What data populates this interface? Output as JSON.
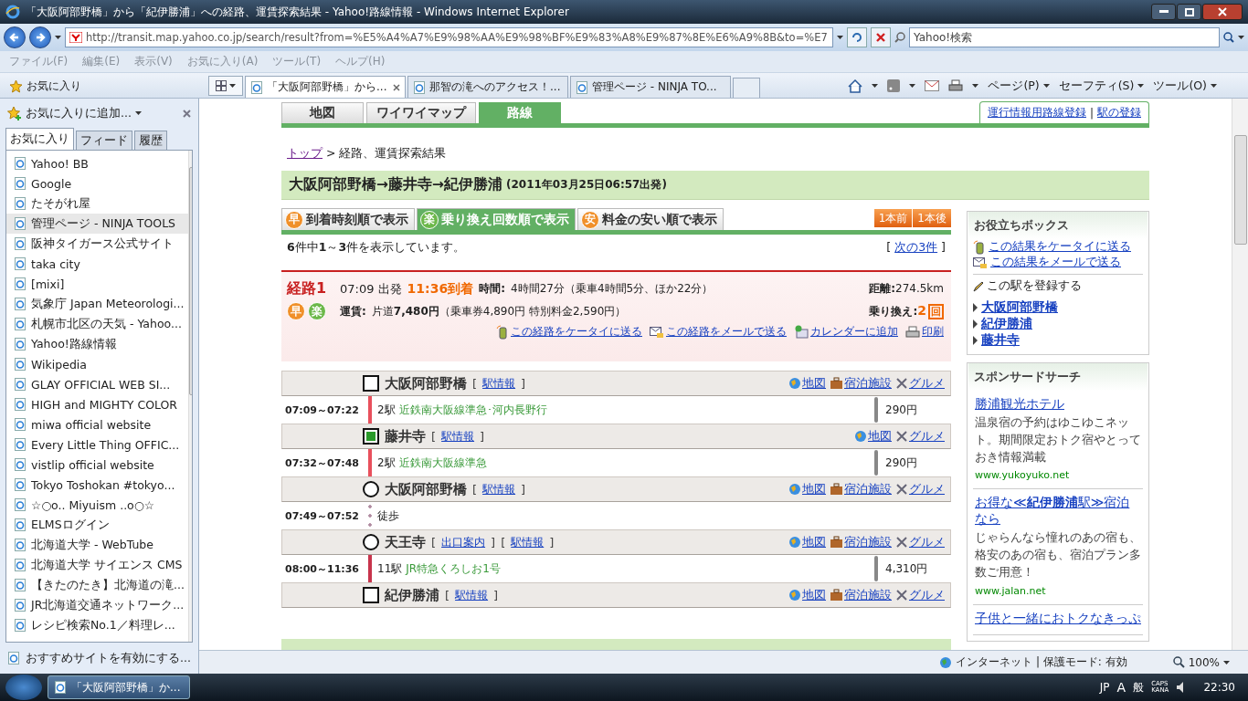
{
  "window": {
    "title": "「大阪阿部野橋」から「紀伊勝浦」への経路、運賃探索結果 - Yahoo!路線情報 - Windows Internet Explorer"
  },
  "address": {
    "url": "http://transit.map.yahoo.co.jp/search/result?from=%E5%A4%A7%E9%98%AA%E9%98%BF%E9%83%A8%E9%87%8E%E6%A9%8B&to=%E7"
  },
  "search": {
    "placeholder": "Yahoo!検索"
  },
  "menu": [
    "ファイル(F)",
    "編集(E)",
    "表示(V)",
    "お気に入り(A)",
    "ツール(T)",
    "ヘルプ(H)"
  ],
  "favorites_button": "お気に入り",
  "browser_tabs": [
    {
      "label": "「大阪阿部野橋」から...",
      "selected": true
    },
    {
      "label": "那智の滝へのアクセス！...",
      "selected": false
    },
    {
      "label": "管理ページ - NINJA TO...",
      "selected": false
    }
  ],
  "command_menus": [
    "ページ(P)",
    "セーフティ(S)",
    "ツール(O)"
  ],
  "favorites_pane": {
    "add_label": "お気に入りに追加...",
    "tabs": [
      {
        "label": "お気に入り",
        "selected": true
      },
      {
        "label": "フィード",
        "selected": false
      },
      {
        "label": "履歴",
        "selected": false
      }
    ],
    "items": [
      {
        "label": "Yahoo! BB",
        "selected": false
      },
      {
        "label": "Google",
        "selected": false
      },
      {
        "label": "たそがれ屋",
        "selected": false
      },
      {
        "label": "管理ページ - NINJA TOOLS",
        "selected": true
      },
      {
        "label": "阪神タイガース公式サイト",
        "selected": false
      },
      {
        "label": "taka city",
        "selected": false
      },
      {
        "label": "[mixi]",
        "selected": false
      },
      {
        "label": "気象庁 Japan Meteorologi...",
        "selected": false
      },
      {
        "label": "札幌市北区の天気 - Yahoo...",
        "selected": false
      },
      {
        "label": "Yahoo!路線情報",
        "selected": false
      },
      {
        "label": "Wikipedia",
        "selected": false
      },
      {
        "label": "GLAY OFFICIAL WEB SI...",
        "selected": false
      },
      {
        "label": "HIGH and MIGHTY COLOR",
        "selected": false
      },
      {
        "label": "miwa official website",
        "selected": false
      },
      {
        "label": "Every Little Thing OFFIC...",
        "selected": false
      },
      {
        "label": "vistlip official website",
        "selected": false
      },
      {
        "label": "Tokyo Toshokan  #tokyo...",
        "selected": false
      },
      {
        "label": "☆○o.. Miyuism ..o○☆",
        "selected": false
      },
      {
        "label": "ELMSログイン",
        "selected": false
      },
      {
        "label": "北海道大学 - WebTube",
        "selected": false
      },
      {
        "label": "北海道大学 サイエンス CMS",
        "selected": false
      },
      {
        "label": "【きたのたき】北海道の滝...",
        "selected": false
      },
      {
        "label": "JR北海道交通ネットワーク...",
        "selected": false
      },
      {
        "label": "レシピ検索No.1／料理レ...",
        "selected": false
      }
    ],
    "footer": "おすすめサイトを有効にする..."
  },
  "page": {
    "nav_tabs": [
      {
        "label": "地図",
        "selected": false
      },
      {
        "label": "ワイワイマップ",
        "selected": false
      },
      {
        "label": "路線",
        "selected": true
      }
    ],
    "header_links": [
      {
        "label": "運行情報用路線登録"
      },
      {
        "separator": "|",
        "label": "駅の登録"
      }
    ],
    "breadcrumb": {
      "link": "トップ",
      "separator": ">",
      "current": "経路、運賃探索結果"
    },
    "route_title": "大阪阿部野橋→藤井寺→紀伊勝浦",
    "route_date": "(2011年03月25日06:57出発)",
    "sort_tabs": [
      {
        "badge": "早",
        "label": "到着時刻順で表示",
        "selected": false
      },
      {
        "badge": "楽",
        "label": "乗り換え回数順で表示",
        "selected": true
      },
      {
        "badge": "安",
        "label": "料金の安い順で表示",
        "selected": false
      }
    ],
    "nav_buttons": [
      "1本前",
      "1本後"
    ],
    "result_count": "**6**件中**1**～**3**件を表示しています。",
    "next_link": {
      "open": "[",
      "label": "次の3件",
      "close": "]"
    },
    "summary": {
      "title": "経路1",
      "depart": "07:09 出発",
      "arrive": "11:36到着",
      "time_label": "時間:",
      "time": "4時間27分（乗車4時間5分、ほか22分）",
      "distance_label": "距離:",
      "distance": "274.5km",
      "badges": [
        "早",
        "楽"
      ],
      "fare_label": "運賃:",
      "fare": "片道**7,480円**（乗車券4,890円 特別料金2,590円）",
      "transfers_label": "乗り換え:",
      "transfers": "2",
      "transfers_unit": "回",
      "actions": [
        {
          "kind": "phone",
          "label": "この経路をケータイに送る"
        },
        {
          "kind": "mail",
          "label": "この経路をメールで送る"
        },
        {
          "kind": "calendar",
          "label": "カレンダーに追加"
        },
        {
          "kind": "print",
          "label": "印刷"
        }
      ]
    },
    "itinerary": [
      {
        "kind": "terminal",
        "name": "大阪阿部野橋",
        "info_links": [
          {
            "open": "[",
            "label": "駅情報",
            "close": "]"
          }
        ],
        "links": [
          {
            "kind": "map",
            "label": "地図"
          },
          {
            "kind": "hotel",
            "label": "宿泊施設"
          },
          {
            "kind": "gourmet",
            "label": "グルメ"
          }
        ]
      },
      {
        "kind": "rail",
        "time": "07:09～07:22",
        "stops": "2駅",
        "line": "近鉄南大阪線準急･河内長野行",
        "fare": "290円",
        "color": "#e8505c"
      },
      {
        "kind": "transfer",
        "name": "藤井寺",
        "info_links": [
          {
            "open": "[",
            "label": "駅情報",
            "close": "]"
          }
        ],
        "links": [
          {
            "kind": "map",
            "label": "地図"
          },
          {
            "kind": "gourmet",
            "label": "グルメ"
          }
        ]
      },
      {
        "kind": "rail",
        "time": "07:32～07:48",
        "stops": "2駅",
        "line": "近鉄南大阪線準急",
        "fare": "290円",
        "color": "#e8505c"
      },
      {
        "kind": "via",
        "name": "大阪阿部野橋",
        "info_links": [
          {
            "open": "[",
            "label": "駅情報",
            "close": "]"
          }
        ],
        "links": [
          {
            "kind": "map",
            "label": "地図"
          },
          {
            "kind": "hotel",
            "label": "宿泊施設"
          },
          {
            "kind": "gourmet",
            "label": "グルメ"
          }
        ]
      },
      {
        "kind": "walk",
        "time": "07:49～07:52",
        "line": "徒歩"
      },
      {
        "kind": "via",
        "name": "天王寺",
        "info_links": [
          {
            "open": "[",
            "label": "出口案内",
            "close": "]"
          },
          {
            "open": "[",
            "label": "駅情報",
            "close": "]"
          }
        ],
        "links": [
          {
            "kind": "map",
            "label": "地図"
          },
          {
            "kind": "hotel",
            "label": "宿泊施設"
          },
          {
            "kind": "gourmet",
            "label": "グルメ"
          }
        ]
      },
      {
        "kind": "rail",
        "time": "08:00～11:36",
        "stops": "11駅",
        "line": "JR特急くろしお1号",
        "fare": "4,310円",
        "color": "#c8344c"
      },
      {
        "kind": "terminal",
        "name": "紀伊勝浦",
        "info_links": [
          {
            "open": "[",
            "label": "駅情報",
            "close": "]"
          }
        ],
        "links": [
          {
            "kind": "map",
            "label": "地図"
          },
          {
            "kind": "hotel",
            "label": "宿泊施設"
          },
          {
            "kind": "gourmet",
            "label": "グルメ"
          }
        ]
      }
    ],
    "useful_box": {
      "title": "お役立ちボックス",
      "links": [
        {
          "kind": "phone",
          "label": "この結果をケータイに送る"
        },
        {
          "kind": "mail",
          "label": "この結果をメールで送る"
        }
      ],
      "register_label": "この駅を登録する",
      "stations": [
        "大阪阿部野橋",
        "紀伊勝浦",
        "藤井寺"
      ]
    },
    "sponsored": {
      "title": "スポンサードサーチ",
      "ads": [
        {
          "title": "勝浦観光ホテル",
          "description": "温泉宿の予約はゆこゆこネット。期間限定おトク宿やとっておき情報満載",
          "url": "www.yukoyuko.net"
        },
        {
          "title": "お得な≪**紀伊勝浦**駅≫宿泊なら",
          "description": "じゃらんなら憧れのあの宿も、格安のあの宿も、宿泊プラン多数ご用意！",
          "url": "www.jalan.net"
        },
        {
          "title": "子供と一緒におトクなきっぷ"
        }
      ]
    }
  },
  "status_bar": {
    "zone": "インターネット | 保護モード: 有効",
    "zoom": "100%"
  },
  "taskbar": {
    "task": "「大阪阿部野橋」か...",
    "language": "JP",
    "ime_mode": "A",
    "ime_label": "般",
    "caps": "CAPS",
    "kana": "KANA",
    "clock": "22:30"
  }
}
